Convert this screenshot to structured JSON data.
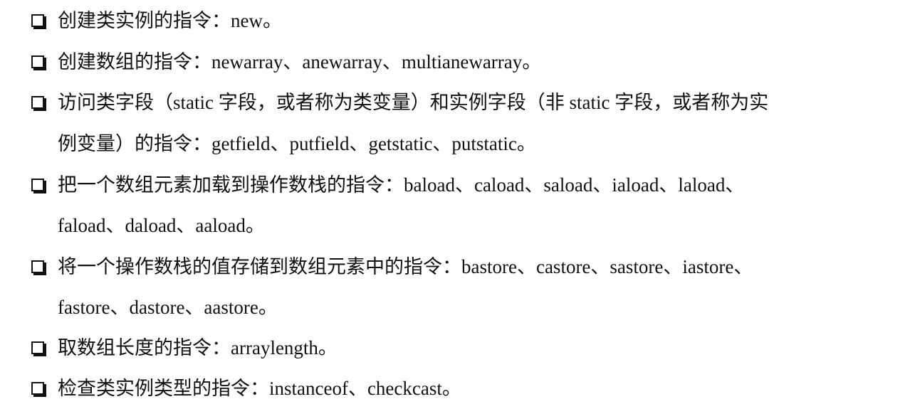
{
  "items": [
    {
      "lines": [
        "创建类实例的指令：new。"
      ]
    },
    {
      "lines": [
        "创建数组的指令：newarray、anewarray、multianewarray。"
      ]
    },
    {
      "lines": [
        "访问类字段（static 字段，或者称为类变量）和实例字段（非 static 字段，或者称为实",
        "例变量）的指令：getfield、putfield、getstatic、putstatic。"
      ]
    },
    {
      "lines": [
        "把一个数组元素加载到操作数栈的指令：baload、caload、saload、iaload、laload、",
        "faload、daload、aaload。"
      ]
    },
    {
      "lines": [
        "将一个操作数栈的值存储到数组元素中的指令：bastore、castore、sastore、iastore、",
        "fastore、dastore、aastore。"
      ]
    },
    {
      "lines": [
        "取数组长度的指令：arraylength。"
      ]
    },
    {
      "lines": [
        "检查类实例类型的指令：instanceof、checkcast。"
      ]
    }
  ]
}
